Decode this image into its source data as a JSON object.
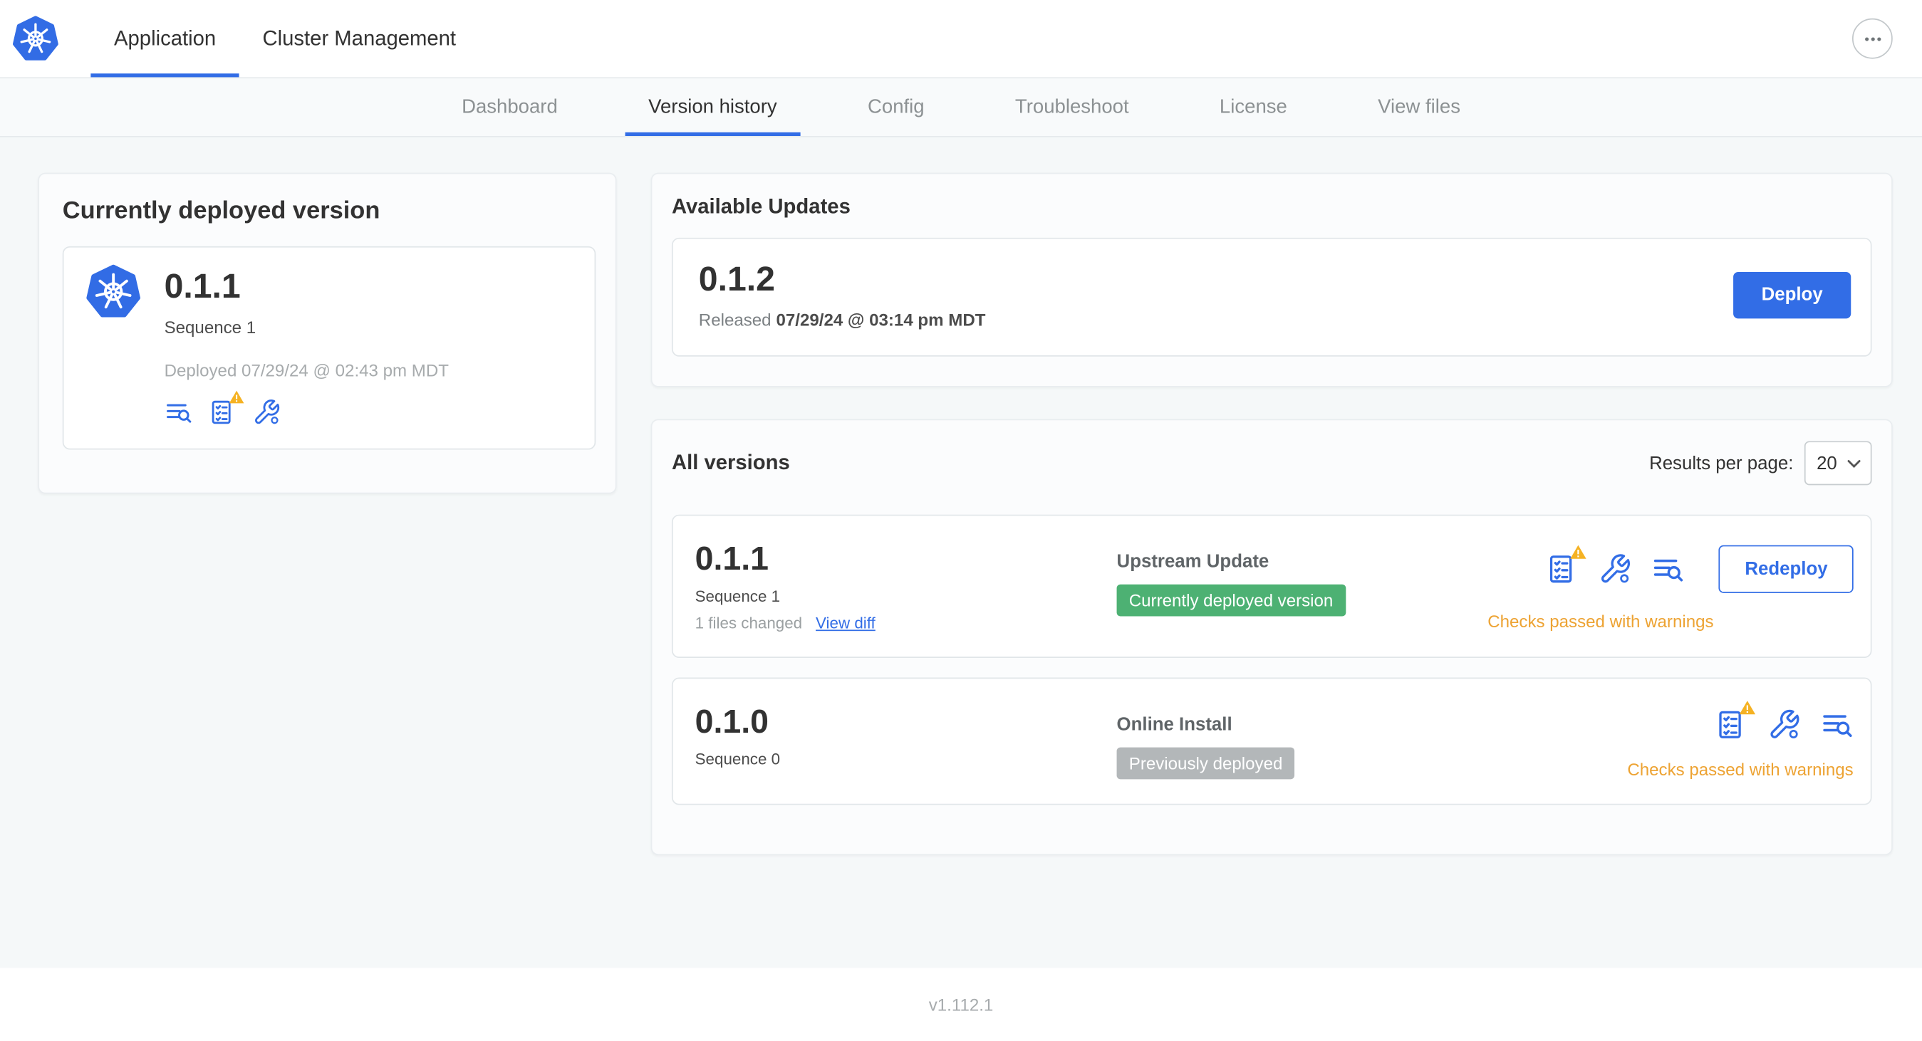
{
  "header": {
    "logo": "kubernetes-logo",
    "tabs": [
      {
        "label": "Application",
        "active": true
      },
      {
        "label": "Cluster Management",
        "active": false
      }
    ],
    "more_menu_icon": "ellipsis-icon"
  },
  "subnav": {
    "items": [
      {
        "label": "Dashboard",
        "active": false
      },
      {
        "label": "Version history",
        "active": true
      },
      {
        "label": "Config",
        "active": false
      },
      {
        "label": "Troubleshoot",
        "active": false
      },
      {
        "label": "License",
        "active": false
      },
      {
        "label": "View files",
        "active": false
      }
    ]
  },
  "current_version": {
    "title": "Currently deployed version",
    "version": "0.1.1",
    "sequence": "Sequence 1",
    "deployed": "Deployed 07/29/24 @ 02:43 pm MDT",
    "icons": [
      "deploy-logs-icon",
      "preflight-checks-icon",
      "config-wrench-icon"
    ]
  },
  "available_updates": {
    "title": "Available Updates",
    "version": "0.1.2",
    "released_prefix": "Released",
    "released_date": "07/29/24 @ 03:14 pm MDT",
    "deploy_label": "Deploy"
  },
  "all_versions": {
    "title": "All versions",
    "results_per_page_label": "Results per page:",
    "results_per_page_value": "20",
    "rows": [
      {
        "version": "0.1.1",
        "sequence": "Sequence 1",
        "files_changed": "1 files changed",
        "view_diff_label": "View diff",
        "source": "Upstream Update",
        "badge": "Currently deployed version",
        "badge_color": "#4db173",
        "action_label": "Redeploy",
        "status": "Checks passed with warnings",
        "icons": [
          "preflight-checks-icon",
          "config-wrench-icon",
          "deploy-logs-icon"
        ]
      },
      {
        "version": "0.1.0",
        "sequence": "Sequence 0",
        "source": "Online Install",
        "badge": "Previously deployed",
        "badge_color": "#b3b7b9",
        "status": "Checks passed with warnings",
        "icons": [
          "preflight-checks-icon",
          "config-wrench-icon",
          "deploy-logs-icon"
        ]
      }
    ]
  },
  "footer": {
    "version": "v1.112.1"
  },
  "colors": {
    "primary_blue": "#326de6",
    "warning_text": "#eda333",
    "warning_triangle": "#f5b223",
    "badge_green": "#4db173",
    "badge_gray": "#b3b7b9",
    "page_background": "#f5f8f9"
  }
}
